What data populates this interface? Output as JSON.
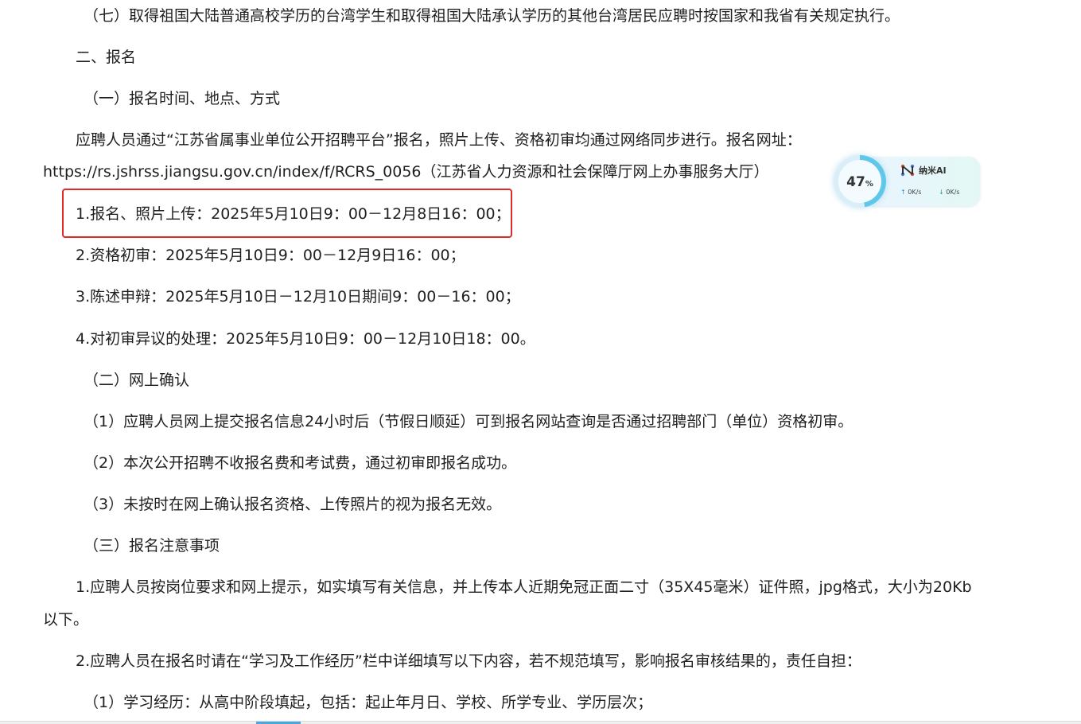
{
  "document": {
    "lines": [
      "（七）取得祖国大陆普通高校学历的台湾学生和取得祖国大陆承认学历的其他台湾居民应聘时按国家和我省有关规定执行。",
      "二、报名",
      "（一）报名时间、地点、方式",
      "应聘人员通过“江苏省属事业单位公开招聘平台”报名，照片上传、资格初审均通过网络同步进行。报名网址：",
      "https://rs.jshrss.jiangsu.gov.cn/index/f/RCRS_0056（江苏省人力资源和社会保障厅网上办事服务大厅）",
      "1.报名、照片上传：2025年5月10日9：00－12月8日16：00；",
      "2.资格初审：2025年5月10日9：00－12月9日16：00；",
      "3.陈述申辩：2025年5月10日－12月10日期间9：00－16：00；",
      "4.对初审异议的处理：2025年5月10日9：00－12月10日18：00。",
      "（二）网上确认",
      "（1）应聘人员网上提交报名信息24小时后（节假日顺延）可到报名网站查询是否通过招聘部门（单位）资格初审。",
      "（2）本次公开招聘不收报名费和考试费，通过初审即报名成功。",
      "（3）未按时在网上确认报名资格、上传照片的视为报名无效。",
      "（三）报名注意事项",
      "1.应聘人员按岗位要求和网上提示，如实填写有关信息，并上传本人近期免冠正面二寸（35X45毫米）证件照，jpg格式，大小为20Kb",
      "以下。",
      "2.应聘人员在报名时请在“学习及工作经历”栏中详细填写以下内容，若不规范填写，影响报名审核结果的，责任自担：",
      "（1）学习经历：从高中阶段填起，包括：起止年月日、学校、所学专业、学历层次；"
    ]
  },
  "widget": {
    "percent": "47",
    "percent_sign": "%",
    "percent_value": 0.47,
    "brand": "纳米AI",
    "upload_speed": "0K/s",
    "download_speed": "0K/s",
    "ring_color": "#5fc7e8"
  },
  "highlight": {
    "color": "#e02a2a"
  }
}
